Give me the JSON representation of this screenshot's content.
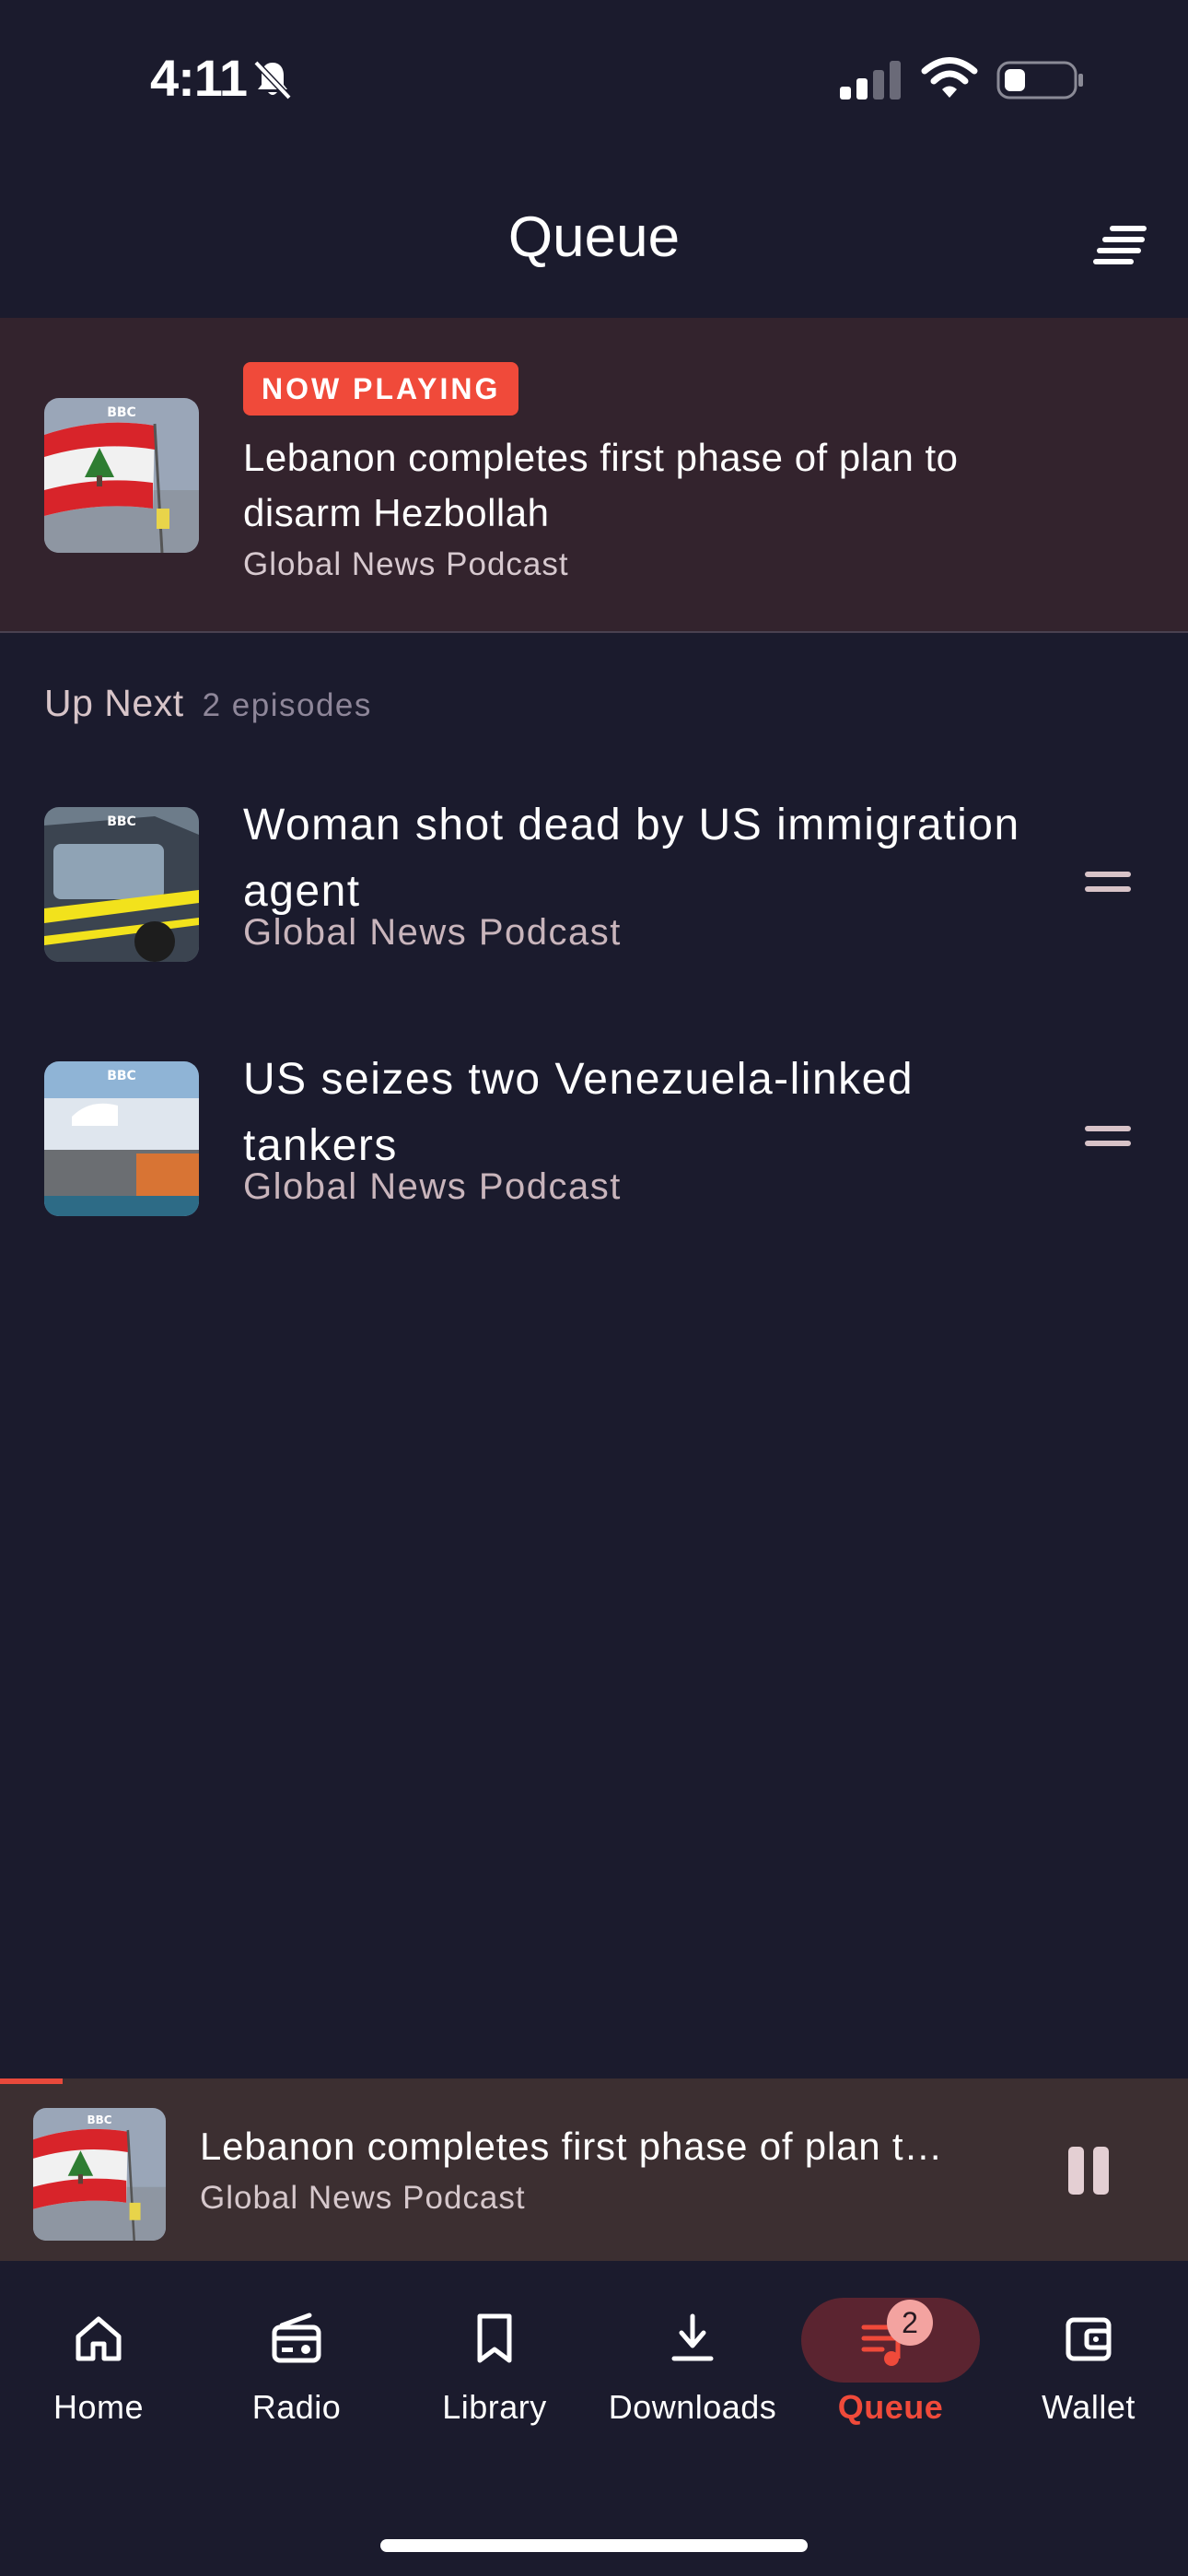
{
  "status_bar": {
    "time": "4:11"
  },
  "header": {
    "title": "Queue"
  },
  "now_playing": {
    "badge": "NOW PLAYING",
    "title": "Lebanon completes first phase of plan to disarm Hezbollah",
    "show": "Global News Podcast",
    "artwork_logo": "BBC"
  },
  "up_next": {
    "label": "Up Next",
    "count": "2 episodes",
    "items": [
      {
        "title": "Woman shot dead by US immigration agent",
        "show": "Global News Podcast",
        "artwork_logo": "BBC"
      },
      {
        "title": "US seizes two Venezuela-linked tankers",
        "show": "Global News Podcast",
        "artwork_logo": "BBC"
      }
    ]
  },
  "mini_player": {
    "title": "Lebanon completes first phase of plan t…",
    "show": "Global News Podcast",
    "progress": 0.053,
    "artwork_logo": "BBC"
  },
  "nav": {
    "home": "Home",
    "radio": "Radio",
    "library": "Library",
    "downloads": "Downloads",
    "queue": "Queue",
    "queue_badge": "2",
    "wallet": "Wallet"
  },
  "colors": {
    "background": "#1b1b2d",
    "accent": "#f04a3a",
    "now_playing_bg": "#33232d",
    "mini_player_bg": "#3c2f31"
  }
}
